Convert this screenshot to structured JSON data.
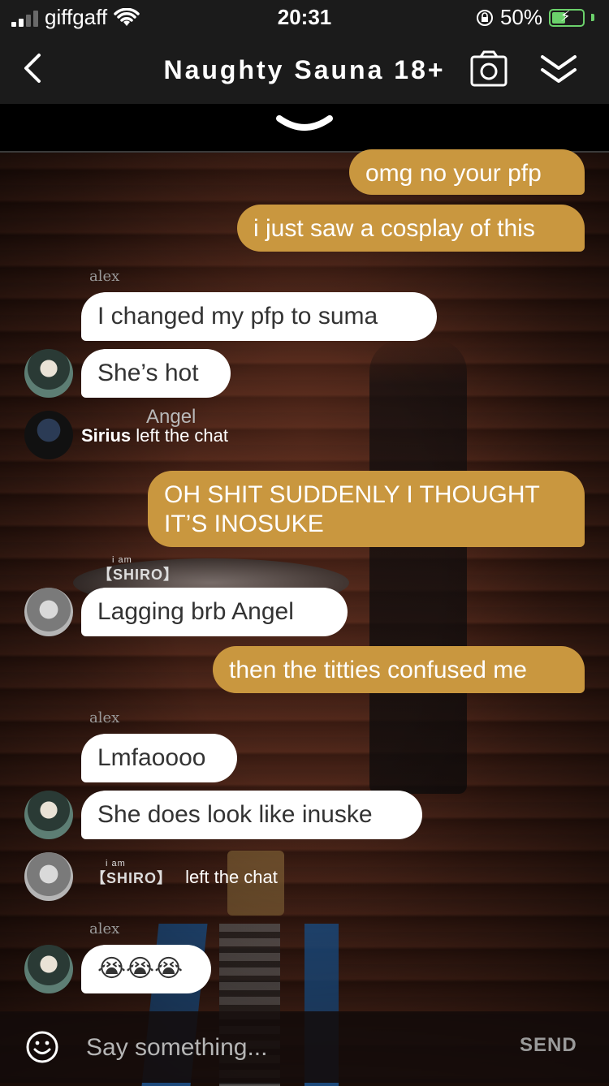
{
  "status_bar": {
    "carrier": "giffgaff",
    "time": "20:31",
    "battery": "50%"
  },
  "header": {
    "title": "Naughty Sauna 18+"
  },
  "messages": [
    {
      "text": "omg no your pfp"
    },
    {
      "text": "i just saw a cosplay of this"
    },
    {
      "sender": "alex",
      "text": "I changed my pfp to suma"
    },
    {
      "text": "She’s hot"
    },
    {
      "name": "Sirius",
      "text": "left the chat",
      "overlay": "Angel"
    },
    {
      "text": "OH SHIT SUDDENLY I THOUGHT IT’S INOSUKE"
    },
    {
      "sender_tag": "SHIRO",
      "sender_prefix": "i am",
      "text": "Lagging brb Angel"
    },
    {
      "text": "then the titties confused me"
    },
    {
      "sender": "alex",
      "text": "Lmfaoooo"
    },
    {
      "text": "She does look like inuske"
    },
    {
      "name_tag": "SHIRO",
      "name_prefix": "i am",
      "text": "left the chat"
    },
    {
      "sender": "alex",
      "text": "😭😭😭"
    }
  ],
  "input": {
    "placeholder": "Say something...",
    "send_label": "SEND"
  }
}
